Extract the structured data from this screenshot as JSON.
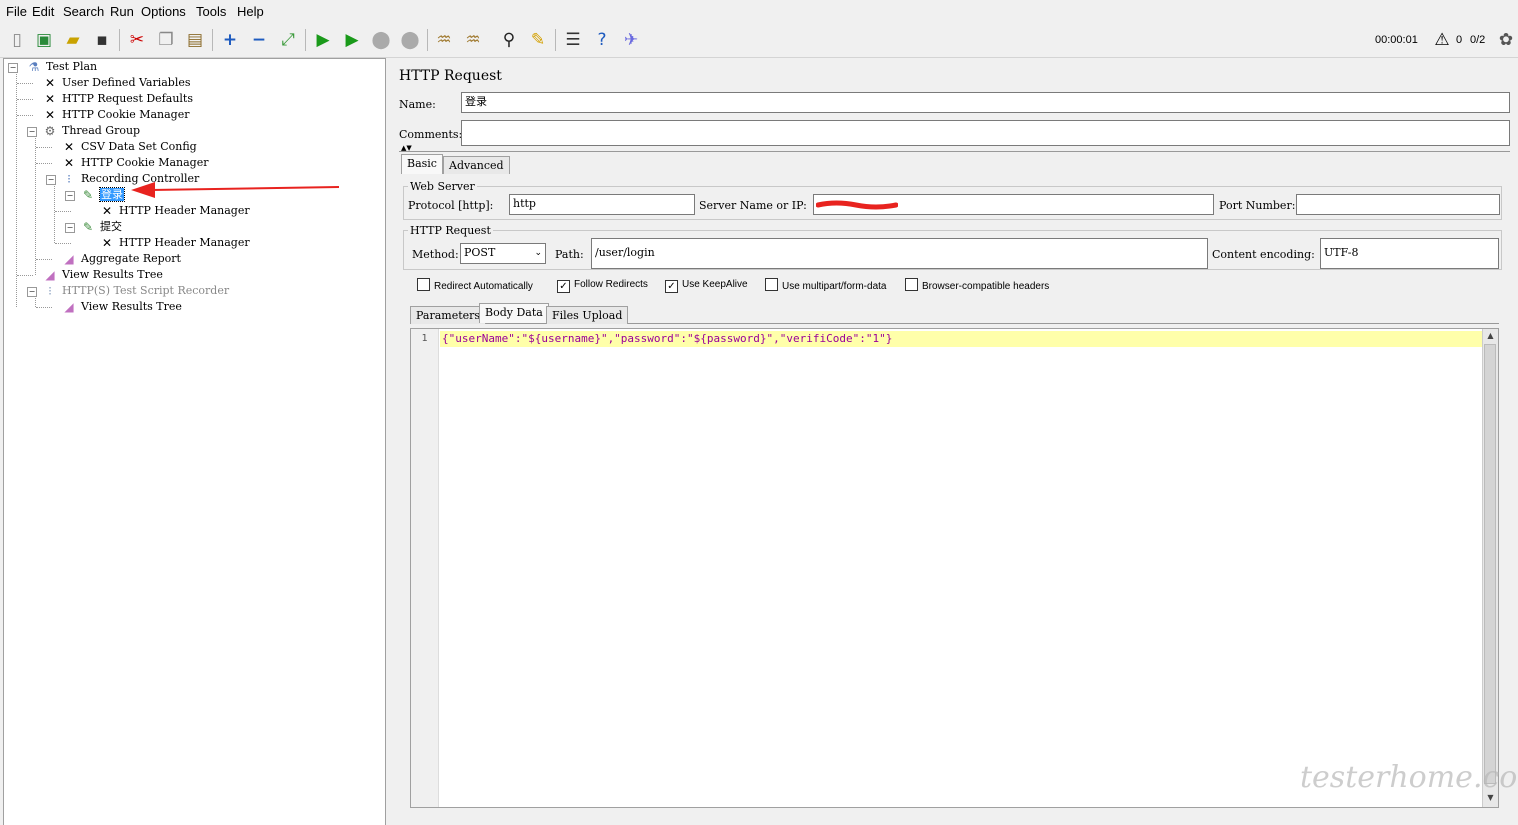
{
  "menu": [
    "File",
    "Edit",
    "Search",
    "Run",
    "Options",
    "Tools",
    "Help"
  ],
  "toolbar": {
    "timer": "00:00:01",
    "warnings": "0",
    "threads": "0/2",
    "icons": [
      "new-icon",
      "templates-icon",
      "open-icon",
      "save-icon",
      "cut-icon",
      "copy-icon",
      "paste-icon",
      "expand-icon",
      "collapse-icon",
      "toggle-icon",
      "start-icon",
      "start-no-pause-icon",
      "stop-icon",
      "shutdown-icon",
      "clear-icon",
      "clear-all-icon",
      "search-icon",
      "reset-search-icon",
      "function-helper-icon",
      "help-icon",
      "remote-icon"
    ]
  },
  "tree": {
    "test_plan": "Test Plan",
    "user_defined_variables": "User Defined Variables",
    "http_request_defaults": "HTTP Request Defaults",
    "http_cookie_manager_top": "HTTP Cookie Manager",
    "thread_group": "Thread Group",
    "csv_data_set_config": "CSV Data Set Config",
    "http_cookie_manager": "HTTP Cookie Manager",
    "recording_controller": "Recording Controller",
    "sampler_login": "登录",
    "header_manager_1": "HTTP Header Manager",
    "sampler_submit": "提交",
    "header_manager_2": "HTTP Header Manager",
    "aggregate_report": "Aggregate Report",
    "view_results_tree": "View Results Tree",
    "script_recorder": "HTTP(S) Test Script Recorder",
    "view_results_tree_2": "View Results Tree"
  },
  "panel": {
    "title": "HTTP Request",
    "name_label": "Name:",
    "name_value": "登录",
    "comments_label": "Comments:",
    "comments_value": "",
    "tabs": [
      "Basic",
      "Advanced"
    ],
    "web_server": {
      "title": "Web Server",
      "protocol_label": "Protocol [http]:",
      "protocol_value": "http",
      "server_label": "Server Name or IP:",
      "server_value": "",
      "port_label": "Port Number:",
      "port_value": ""
    },
    "http_request": {
      "title": "HTTP Request",
      "method_label": "Method:",
      "method_value": "POST",
      "path_label": "Path:",
      "path_value": "/user/login",
      "encoding_label": "Content encoding:",
      "encoding_value": "UTF-8"
    },
    "checkboxes": [
      {
        "label": "Redirect Automatically",
        "checked": false
      },
      {
        "label": "Follow Redirects",
        "checked": true
      },
      {
        "label": "Use KeepAlive",
        "checked": true
      },
      {
        "label": "Use multipart/form-data",
        "checked": false
      },
      {
        "label": "Browser-compatible headers",
        "checked": false
      }
    ],
    "body_tabs": [
      "Parameters",
      "Body Data",
      "Files Upload"
    ],
    "body": {
      "line_number": "1",
      "code": "{\"userName\":\"${username}\",\"password\":\"${password}\",\"verifiCode\":\"1\"}"
    }
  },
  "watermark": "testerhome.com",
  "colors": {
    "selection": "#3399ff",
    "annotation_arrow": "#e8231f",
    "code_highlight": "#ffffaa"
  }
}
